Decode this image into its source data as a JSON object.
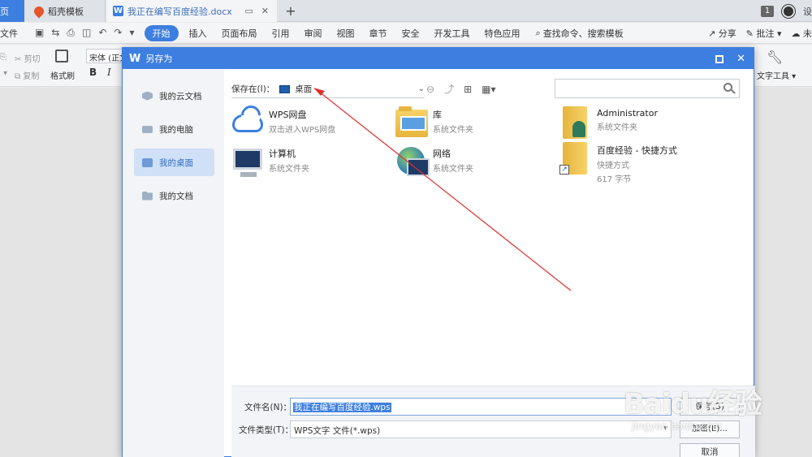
{
  "tabs": {
    "home": "页",
    "daoke": "稻壳模板",
    "doc": "我正在编写百度经验.docx",
    "badge": "1",
    "settings": "设"
  },
  "menubar": {
    "file": "文件",
    "items": [
      "开始",
      "插入",
      "页面布局",
      "引用",
      "审阅",
      "视图",
      "章节",
      "安全",
      "开发工具",
      "特色应用"
    ],
    "search": "查找命令、搜索模板",
    "share": "分享",
    "comment": "批注",
    "cloud": "未"
  },
  "ribbon": {
    "cut": "剪切",
    "copy": "复制",
    "format_brush": "格式刷",
    "font": "宋体 (正文)",
    "bold": "B",
    "italic": "I",
    "text_tools": "文字工具"
  },
  "dialog": {
    "title": "另存为",
    "sidebar": [
      "我的云文档",
      "我的电脑",
      "我的桌面",
      "我的文档"
    ],
    "save_in_label": "保存在(I)：",
    "save_in_value": "桌面",
    "search_placeholder": "",
    "files": [
      {
        "name": "WPS网盘",
        "sub": "双击进入WPS网盘",
        "icon": "cloud-icon"
      },
      {
        "name": "库",
        "sub": "系统文件夹",
        "icon": "library-folder-icon"
      },
      {
        "name": "Administrator",
        "sub": "系统文件夹",
        "icon": "user-folder-icon"
      },
      {
        "name": "计算机",
        "sub": "系统文件夹",
        "icon": "computer-icon"
      },
      {
        "name": "网络",
        "sub": "系统文件夹",
        "icon": "network-icon"
      },
      {
        "name": "百度经验 - 快捷方式",
        "sub": "快捷方式",
        "sub2": "617 字节",
        "icon": "shortcut-folder-icon"
      }
    ],
    "filename_label": "文件名(N)：",
    "filename_value": "我正在编写百度经验.wps",
    "filetype_label": "文件类型(T)：",
    "filetype_value": "WPS文字 文件(*.wps)",
    "save_button": "保存(S)",
    "encrypt_button": "加密(E)...",
    "cancel_button": "取消"
  },
  "watermark": {
    "logo": "Baidu经验",
    "sub": "jingyan.baidu.com"
  },
  "colors": {
    "accent": "#3d7fe0",
    "arrow": "#e03030"
  }
}
